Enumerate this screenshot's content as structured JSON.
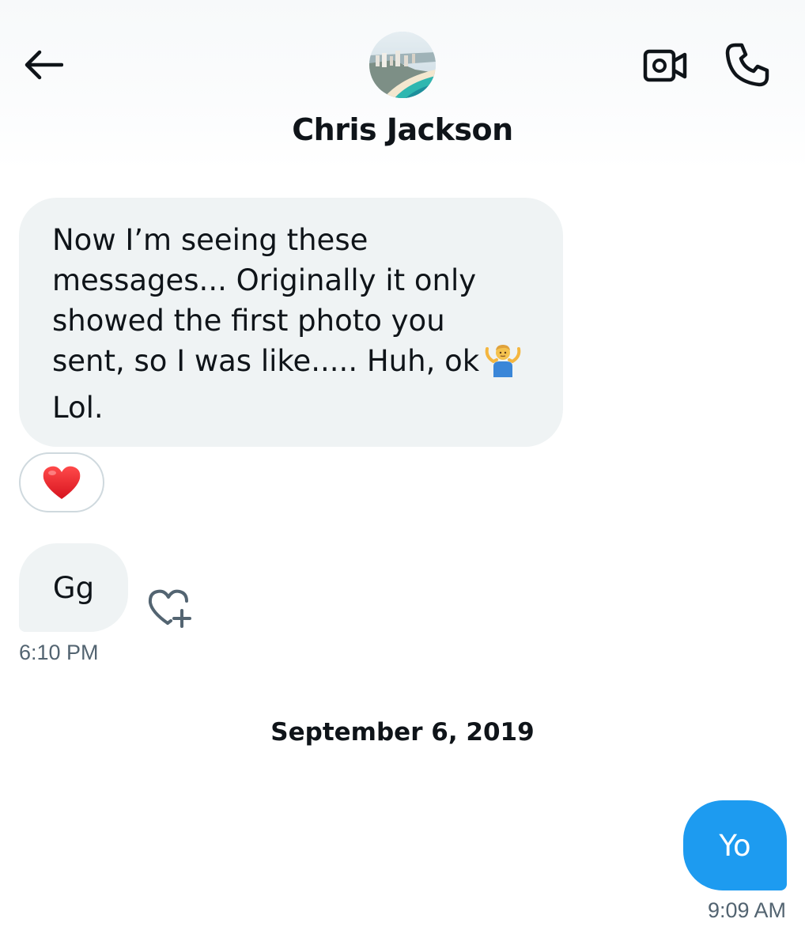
{
  "header": {
    "contact_name": "Chris Jackson",
    "back_icon": "arrow-left-icon",
    "video_icon": "video-camera-icon",
    "call_icon": "phone-icon",
    "avatar": "beach-coastline-photo"
  },
  "messages": [
    {
      "direction": "incoming",
      "lines": [
        "Now I’m seeing these",
        "messages... Originally it only",
        "showed the first photo you",
        "sent, so I was like..... Huh, ok",
        "Lol."
      ],
      "emoji": "person-shrugging",
      "reaction": "red-heart"
    },
    {
      "direction": "incoming",
      "text": "Gg",
      "time": "6:10 PM",
      "add_reaction_icon": "heart-plus-icon"
    }
  ],
  "date_separator": "September 6, 2019",
  "outgoing": {
    "text": "Yo",
    "time": "9:09 AM"
  },
  "colors": {
    "incoming_bubble": "#eff3f4",
    "outgoing_bubble": "#1d9bf0",
    "secondary_text": "#536471",
    "primary_text": "#0f1419"
  }
}
